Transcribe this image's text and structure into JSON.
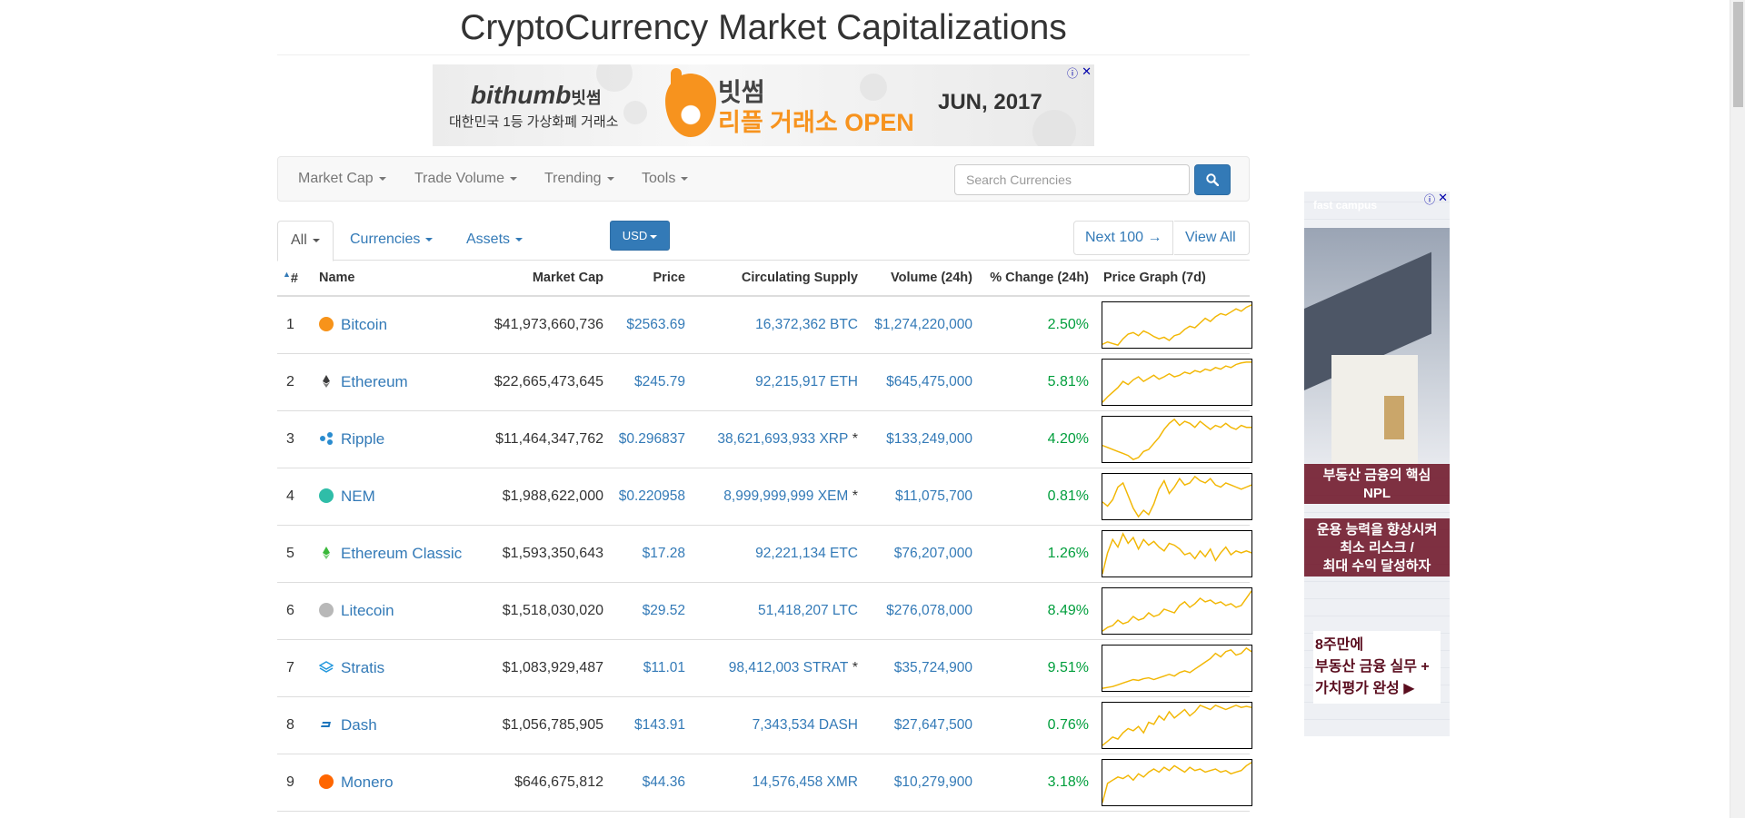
{
  "page": {
    "title": "CryptoCurrency Market Capitalizations"
  },
  "top_ad": {
    "brand": "bithumb",
    "brand_kr": "빗썸",
    "tagline": "대한민국 1등 가상화폐 거래소",
    "headline1": "빗썸",
    "headline2": "리플 거래소 OPEN",
    "date": "JUN, 2017",
    "info_icon": "ⓘ",
    "close_icon": "✕"
  },
  "navbar": {
    "items": [
      "Market Cap",
      "Trade Volume",
      "Trending",
      "Tools"
    ],
    "search_placeholder": "Search Currencies"
  },
  "filters": {
    "tabs": [
      "All",
      "Currencies",
      "Assets"
    ],
    "currency": "USD",
    "next": "Next 100 →",
    "view_all": "View All"
  },
  "table": {
    "headers": {
      "rank": "#",
      "name": "Name",
      "market_cap": "Market Cap",
      "price": "Price",
      "supply": "Circulating Supply",
      "volume": "Volume (24h)",
      "change": "% Change (24h)",
      "graph": "Price Graph (7d)"
    },
    "rows": [
      {
        "rank": "1",
        "name": "Bitcoin",
        "market_cap": "$41,973,660,736",
        "price": "$2563.69",
        "supply": "16,372,362 BTC",
        "star": "",
        "volume": "$1,274,220,000",
        "change": "2.50%",
        "icon": "bitcoin-icon",
        "color": "#f7931a",
        "spark": [
          5,
          8,
          6,
          4,
          12,
          18,
          20,
          16,
          22,
          19,
          15,
          12,
          14,
          10,
          16,
          18,
          24,
          28,
          26,
          32,
          38,
          34,
          40,
          44,
          42,
          46,
          50,
          47,
          52,
          55
        ]
      },
      {
        "rank": "2",
        "name": "Ethereum",
        "market_cap": "$22,665,473,645",
        "price": "$245.79",
        "supply": "92,215,917 ETH",
        "star": "",
        "volume": "$645,475,000",
        "change": "5.81%",
        "icon": "ethereum-icon",
        "color": "#3c3c3d",
        "spark": [
          3,
          10,
          16,
          22,
          30,
          26,
          32,
          36,
          30,
          34,
          38,
          33,
          36,
          40,
          36,
          38,
          42,
          40,
          44,
          42,
          46,
          44,
          48,
          46,
          50,
          48,
          52,
          54,
          55,
          55
        ]
      },
      {
        "rank": "3",
        "name": "Ripple",
        "market_cap": "$11,464,347,762",
        "price": "$0.296837",
        "supply": "38,621,693,933 XRP",
        "star": " *",
        "volume": "$133,249,000",
        "change": "4.20%",
        "icon": "ripple-icon",
        "color": "#2a8ccf",
        "spark": [
          20,
          18,
          16,
          14,
          12,
          10,
          6,
          8,
          14,
          16,
          22,
          28,
          36,
          42,
          46,
          40,
          44,
          42,
          38,
          44,
          40,
          36,
          40,
          38,
          42,
          38,
          36,
          40,
          38,
          38
        ]
      },
      {
        "rank": "4",
        "name": "NEM",
        "market_cap": "$1,988,622,000",
        "price": "$0.220958",
        "supply": "8,999,999,999 XEM",
        "star": " *",
        "volume": "$11,075,700",
        "change": "0.81%",
        "icon": "nem-icon",
        "color": "#2fbda8",
        "spark": [
          22,
          18,
          24,
          36,
          40,
          28,
          16,
          8,
          14,
          10,
          20,
          34,
          42,
          30,
          36,
          44,
          38,
          40,
          46,
          42,
          40,
          44,
          38,
          36,
          40,
          38,
          36,
          34,
          36,
          38
        ]
      },
      {
        "rank": "5",
        "name": "Ethereum Classic",
        "market_cap": "$1,593,350,643",
        "price": "$17.28",
        "supply": "92,221,134 ETC",
        "star": "",
        "volume": "$76,207,000",
        "change": "1.26%",
        "icon": "ethereum-classic-icon",
        "color": "#3ab83a",
        "spark": [
          2,
          24,
          38,
          30,
          44,
          34,
          40,
          28,
          38,
          32,
          36,
          30,
          26,
          34,
          32,
          28,
          22,
          24,
          18,
          26,
          20,
          28,
          16,
          24,
          30,
          22,
          26,
          24,
          26,
          24
        ]
      },
      {
        "rank": "6",
        "name": "Litecoin",
        "market_cap": "$1,518,030,020",
        "price": "$29.52",
        "supply": "51,418,207 LTC",
        "star": "",
        "volume": "$276,078,000",
        "change": "8.49%",
        "icon": "litecoin-icon",
        "color": "#b8b8b8",
        "spark": [
          6,
          10,
          12,
          18,
          14,
          16,
          22,
          18,
          20,
          26,
          22,
          24,
          30,
          28,
          26,
          34,
          38,
          32,
          36,
          42,
          38,
          40,
          36,
          38,
          34,
          36,
          32,
          34,
          42,
          50
        ]
      },
      {
        "rank": "7",
        "name": "Stratis",
        "market_cap": "$1,083,929,487",
        "price": "$11.01",
        "supply": "98,412,003 STRAT",
        "star": " *",
        "volume": "$35,724,900",
        "change": "9.51%",
        "icon": "stratis-icon",
        "color": "#2398dd",
        "spark": [
          4,
          5,
          6,
          8,
          10,
          12,
          14,
          13,
          15,
          16,
          14,
          16,
          18,
          20,
          18,
          22,
          24,
          22,
          26,
          30,
          34,
          38,
          44,
          40,
          46,
          48,
          42,
          44,
          50,
          46
        ]
      },
      {
        "rank": "8",
        "name": "Dash",
        "market_cap": "$1,056,785,905",
        "price": "$143.91",
        "supply": "7,343,534 DASH",
        "star": "",
        "volume": "$27,647,500",
        "change": "0.76%",
        "icon": "dash-icon",
        "color": "#1c75bc",
        "spark": [
          6,
          10,
          14,
          12,
          18,
          22,
          20,
          24,
          18,
          28,
          26,
          34,
          30,
          38,
          32,
          36,
          40,
          34,
          38,
          44,
          42,
          40,
          44,
          42,
          40,
          42,
          44,
          42,
          43,
          42
        ]
      },
      {
        "rank": "9",
        "name": "Monero",
        "market_cap": "$646,675,812",
        "price": "$44.36",
        "supply": "14,576,458 XMR",
        "star": "",
        "volume": "$10,279,900",
        "change": "3.18%",
        "icon": "monero-icon",
        "color": "#ff6600",
        "spark": [
          2,
          26,
          30,
          34,
          32,
          36,
          30,
          38,
          34,
          40,
          44,
          40,
          46,
          42,
          48,
          44,
          40,
          46,
          42,
          44,
          40,
          42,
          44,
          40,
          42,
          38,
          40,
          42,
          48,
          52
        ]
      }
    ]
  },
  "side_ad": {
    "brand": "fast campus",
    "band1": "부동산 금융의 핵심\nNPL",
    "band2": "운용 능력을 향상시켜\n최소 리스크 /\n최대 수익 달성하자",
    "box": "8주만에\n부동산 금융 실무 +\n가치평가 완성 ▶",
    "info_icon": "ⓘ",
    "close_icon": "✕"
  }
}
